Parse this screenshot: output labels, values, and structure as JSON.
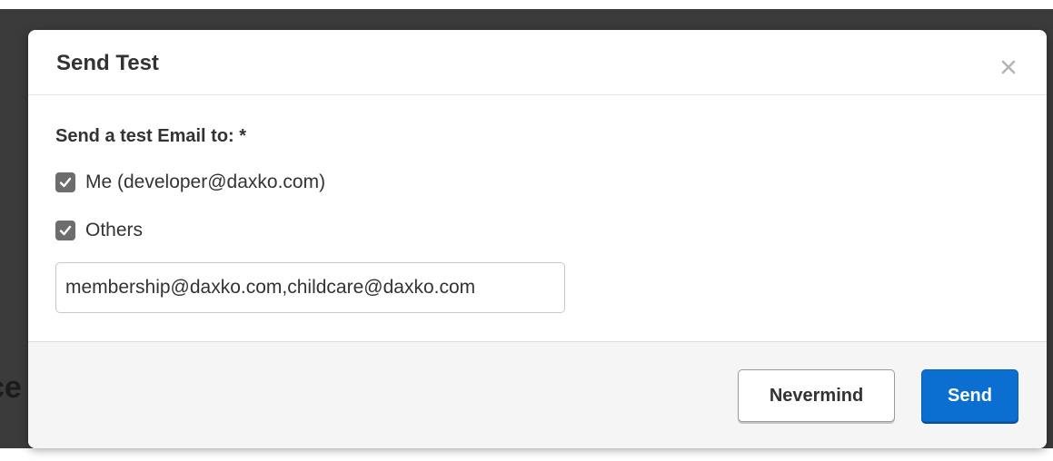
{
  "modal": {
    "title": "Send Test",
    "close_icon": "close-icon"
  },
  "form": {
    "label": "Send a test Email to: *",
    "options": [
      {
        "label": "Me (developer@daxko.com)",
        "checked": true
      },
      {
        "label": "Others",
        "checked": true
      }
    ],
    "other_emails_value": "membership@daxko.com,childcare@daxko.com"
  },
  "footer": {
    "nevermind_label": "Nevermind",
    "send_label": "Send"
  },
  "colors": {
    "send_button": "#0b6fd1",
    "checkbox": "#6d6d6d",
    "backdrop": "#3b3b3b"
  }
}
